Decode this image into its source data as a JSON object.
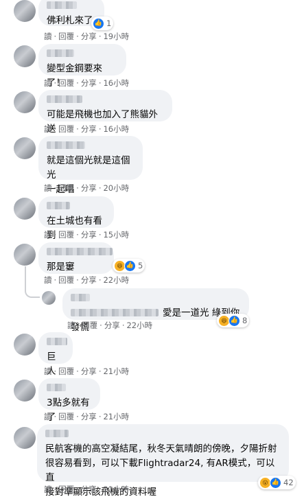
{
  "actions": {
    "read": "讀",
    "reply": "回覆",
    "share": "分享",
    "dot": "·"
  },
  "comments": [
    {
      "text": "佛利札來了",
      "time": "19小時",
      "reactions": {
        "icons": [
          "like-icon"
        ],
        "count": "1"
      }
    },
    {
      "text": "變型金鋼要來了！",
      "time": "16小時"
    },
    {
      "text": "可能是飛機也加入了熊貓外送",
      "time": "16小時"
    },
    {
      "text": "就是這個光就是這個光\n一起唱",
      "time": "20小時"
    },
    {
      "text": "在土城也有看到",
      "time": "15小時"
    },
    {
      "text": "那是窶",
      "time": "22小時",
      "reactions": {
        "icons": [
          "haha-icon",
          "like-icon"
        ],
        "count": "5"
      }
    },
    {
      "text": "愛是一道光 綠到你發慌",
      "time": "22小時",
      "reply": true,
      "reactions": {
        "icons": [
          "haha-icon",
          "like-icon"
        ],
        "count": "8"
      }
    },
    {
      "text": "巨人",
      "time": "21小時"
    },
    {
      "text": "3點多就有了",
      "time": "21小時"
    },
    {
      "text": "民航客機的高空凝結尾，秋冬天氣晴朗的傍晚，夕陽折射\n很容易看到，可以下載Flightradar24, 有AR模式，可以直\n接對準顯示該飛機的資料喔",
      "time": "21小時",
      "reactions": {
        "icons": [
          "wow-icon",
          "like-icon"
        ],
        "count": "42"
      }
    }
  ]
}
